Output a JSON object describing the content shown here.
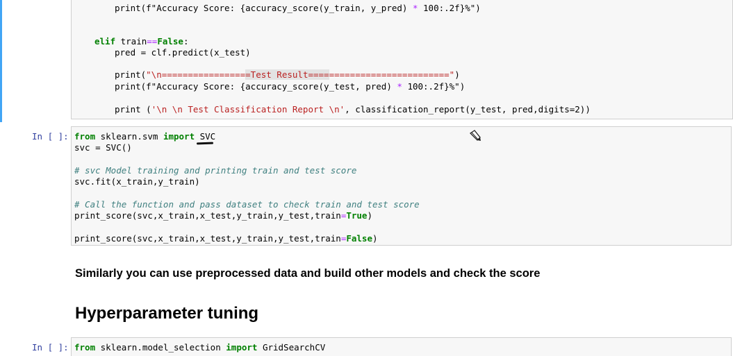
{
  "cell1": {
    "line1_pre": "print(f\"Accuracy Score: {accuracy_score(y_train, y_pred) ",
    "line1_op": "*",
    "line1_post": " 100:.2f}%\")",
    "line2_kw": "elif",
    "line2_mid": " train",
    "line2_op": "==",
    "line2_val": "False",
    "line2_end": ":",
    "line3": "pred = clf.predict(x_test)",
    "line4_fn": "print(",
    "line4_str_a": "\"\\n================",
    "line4_str_hl": "=Test Result====",
    "line4_str_b": "=======================\"",
    "line4_end": ")",
    "line5_pre": "print(f\"Accuracy Score: {accuracy_score(y_test, pred) ",
    "line5_op": "*",
    "line5_post": " 100:.2f}%\")",
    "line6_fn": "print (",
    "line6_str": "'\\n \\n Test Classification Report \\n'",
    "line6_post": ", classification_report(y_test, pred,digits=2))"
  },
  "cell2": {
    "prompt": "In [ ]:",
    "l1_kw1": "from",
    "l1_mod": " sklearn.svm ",
    "l1_kw2": "import",
    "l1_name": " SVC",
    "l2": "svc = SVC()",
    "l3_comment": "# svc Model training and printing train and test score",
    "l4": "svc.fit(x_train,y_train)",
    "l5_comment": "# Call the function and pass dataset to check train and test score",
    "l6_pre": "print_score(svc,x_train,x_test,y_train,y_test,train",
    "l6_op": "=",
    "l6_val": "True",
    "l6_end": ")",
    "l7_pre": "print_score(svc,x_train,x_test,y_train,y_test,train",
    "l7_op": "=",
    "l7_val": "False",
    "l7_end": ")"
  },
  "markdown": {
    "text": "Similarly you can use preprocessed data and build other models and check the score",
    "heading": "Hyperparameter tuning"
  },
  "cell3": {
    "prompt": "In [ ]:",
    "kw1": "from",
    "mod": " sklearn.model_selection ",
    "kw2": "import",
    "name": " GridSearchCV"
  },
  "icons": {
    "cursor": "pencil-cursor-icon"
  }
}
